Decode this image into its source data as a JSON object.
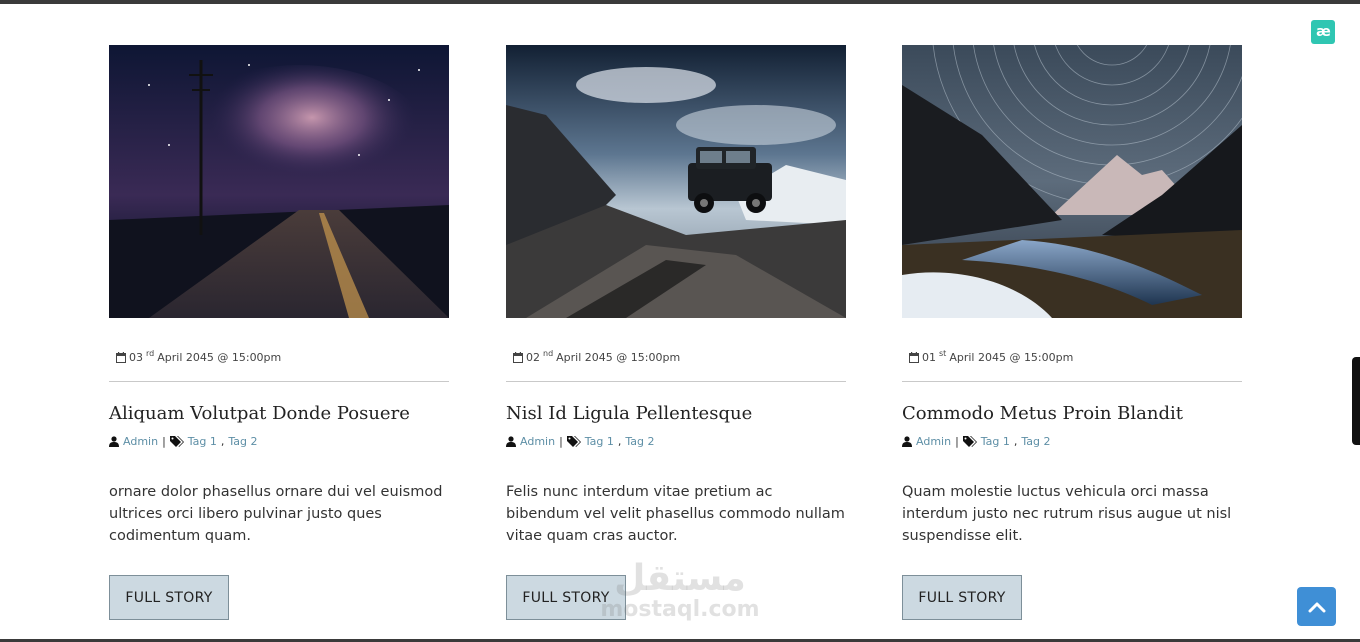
{
  "brand": {
    "badge_text": "æ"
  },
  "cards": [
    {
      "image_alt": "Night road under a starry sky with a utility pole",
      "day": "03",
      "suffix": "rd",
      "date_rest": "April 2045 @ 15:00pm",
      "title": "Aliquam Volutpat Donde Posuere",
      "author": "Admin",
      "tag1": "Tag 1",
      "tag2": "Tag 2",
      "excerpt": "ornare dolor phasellus ornare dui vel euismod ultrices orci libero pulvinar justo ques codimentum quam.",
      "button": "FULL STORY"
    },
    {
      "image_alt": "Off-road SUV driving over rocky terrain under stormy sky",
      "day": "02",
      "suffix": "nd",
      "date_rest": "April 2045 @ 15:00pm",
      "title": "Nisl Id Ligula Pellentesque",
      "author": "Admin",
      "tag1": "Tag 1",
      "tag2": "Tag 2",
      "excerpt": "Felis nunc interdum vitae pretium ac bibendum vel velit phasellus commodo nullam vitae quam cras auctor.",
      "button": "FULL STORY"
    },
    {
      "image_alt": "Star trails over a mountain valley with a river",
      "day": "01",
      "suffix": "st",
      "date_rest": "April 2045 @ 15:00pm",
      "title": "Commodo Metus Proin Blandit",
      "author": "Admin",
      "tag1": "Tag 1",
      "tag2": "Tag 2",
      "excerpt": "Quam molestie luctus vehicula orci massa interdum justo nec rutrum risus augue ut nisl suspendisse elit.",
      "button": "FULL STORY"
    }
  ],
  "watermark": {
    "arabic": "مستقل",
    "latin": "mostaql.com"
  },
  "icons": {
    "calendar": "calendar-icon",
    "user": "user-icon",
    "tags": "tags-icon",
    "back_to_top": "chevron-up-icon"
  },
  "colors": {
    "button_bg": "#ccd9e1",
    "link": "#5e8fa6",
    "back_to_top": "#3f8fd6",
    "brand_badge": "#2fc6b2"
  }
}
